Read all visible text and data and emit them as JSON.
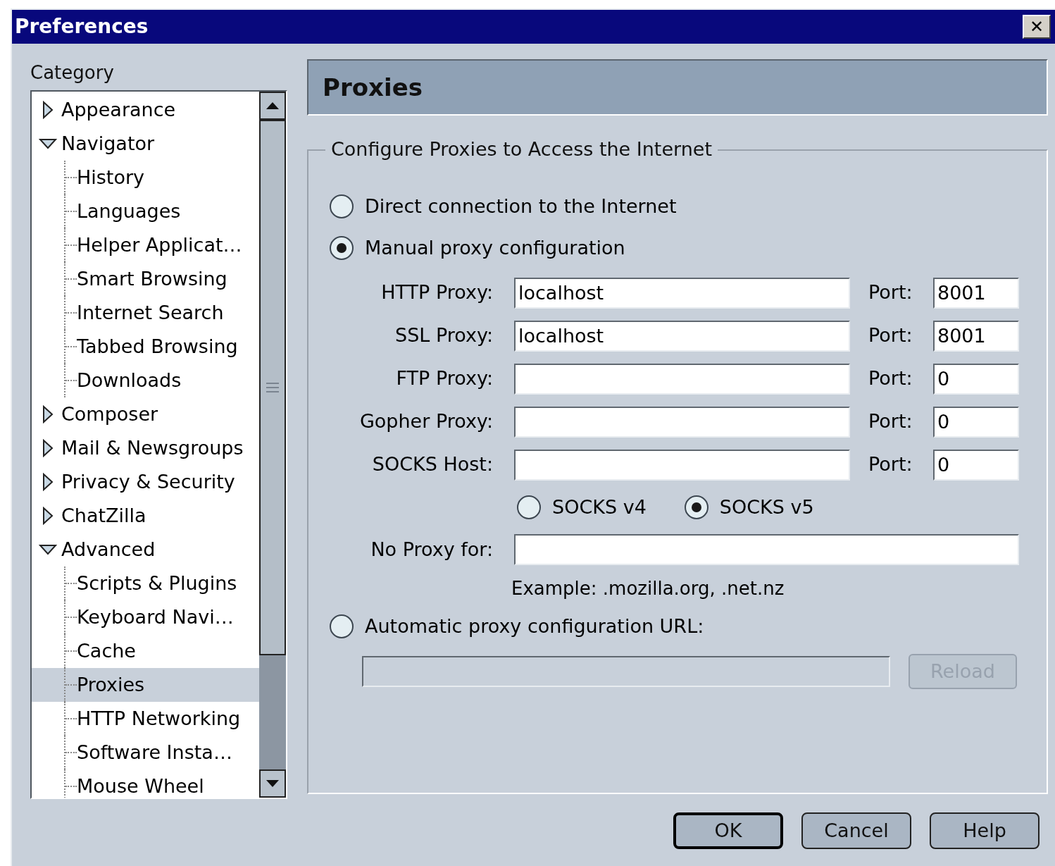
{
  "window": {
    "title": "Preferences",
    "close": "✕"
  },
  "sidebar": {
    "label": "Category",
    "items": [
      {
        "label": "Appearance",
        "expanded": false,
        "selected": false
      },
      {
        "label": "Navigator",
        "expanded": true,
        "selected": false,
        "children": [
          {
            "label": "History",
            "selected": false
          },
          {
            "label": "Languages",
            "selected": false
          },
          {
            "label": "Helper Applicat…",
            "selected": false
          },
          {
            "label": "Smart Browsing",
            "selected": false
          },
          {
            "label": "Internet Search",
            "selected": false
          },
          {
            "label": "Tabbed Browsing",
            "selected": false
          },
          {
            "label": "Downloads",
            "selected": false
          }
        ]
      },
      {
        "label": "Composer",
        "expanded": false,
        "selected": false
      },
      {
        "label": "Mail & Newsgroups",
        "expanded": false,
        "selected": false
      },
      {
        "label": "Privacy & Security",
        "expanded": false,
        "selected": false
      },
      {
        "label": "ChatZilla",
        "expanded": false,
        "selected": false
      },
      {
        "label": "Advanced",
        "expanded": true,
        "selected": false,
        "children": [
          {
            "label": "Scripts & Plugins",
            "selected": false
          },
          {
            "label": "Keyboard Navi…",
            "selected": false
          },
          {
            "label": "Cache",
            "selected": false
          },
          {
            "label": "Proxies",
            "selected": true
          },
          {
            "label": "HTTP Networking",
            "selected": false
          },
          {
            "label": "Software Insta…",
            "selected": false
          },
          {
            "label": "Mouse Wheel",
            "selected": false
          }
        ]
      }
    ]
  },
  "panel": {
    "title": "Proxies",
    "group_title": "Configure Proxies to Access the Internet",
    "direct": {
      "label": "Direct connection to the Internet",
      "selected": false
    },
    "manual": {
      "label": "Manual proxy configuration",
      "selected": true
    },
    "proxies": [
      {
        "label": "HTTP Proxy:",
        "value": "localhost",
        "port_label": "Port:",
        "port": "8001"
      },
      {
        "label": "SSL Proxy:",
        "value": "localhost",
        "port_label": "Port:",
        "port": "8001"
      },
      {
        "label": "FTP Proxy:",
        "port_label": "Port:",
        "port": "0"
      },
      {
        "label": "Gopher Proxy:",
        "port_label": "Port:",
        "port": "0"
      },
      {
        "label": "SOCKS Host:",
        "port_label": "Port:",
        "port": "0"
      }
    ],
    "socks_versions": [
      {
        "label": "SOCKS v4",
        "selected": false
      },
      {
        "label": "SOCKS v5",
        "selected": true
      }
    ],
    "no_proxy": {
      "label": "No Proxy for:"
    },
    "example": "Example: .mozilla.org, .net.nz",
    "auto": {
      "label": "Automatic proxy configuration URL:",
      "selected": false,
      "disabled": true
    },
    "reload": {
      "label": "Reload",
      "disabled": true
    }
  },
  "buttons": [
    {
      "label": "OK",
      "default": true
    },
    {
      "label": "Cancel",
      "default": false
    },
    {
      "label": "Help",
      "default": false
    }
  ]
}
